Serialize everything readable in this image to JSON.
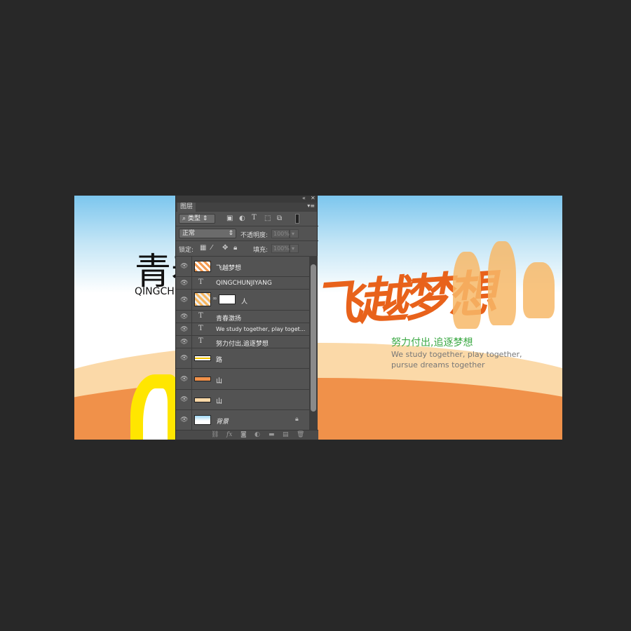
{
  "canvas": {
    "title": "青春",
    "subtitle": "QINGCHU",
    "calligraphy": "飞越梦想",
    "slogan": "努力付出,追逐梦想",
    "english_line1": "We study together, play together,",
    "english_line2": "pursue dreams together"
  },
  "panel": {
    "tab": "图层",
    "filter_kind": "类型",
    "blend_mode": "正常",
    "opacity_label": "不透明度:",
    "opacity_value": "100%",
    "lock_label": "锁定:",
    "fill_label": "填充:",
    "fill_value": "100%",
    "layers": [
      {
        "name": "飞越梦想",
        "type": "image"
      },
      {
        "name": "QINGCHUNJIYANG",
        "type": "text"
      },
      {
        "name": "人",
        "type": "image-mask"
      },
      {
        "name": "青春激扬",
        "type": "text"
      },
      {
        "name": "We study together, play toget...",
        "type": "text"
      },
      {
        "name": "努力付出,追逐梦想",
        "type": "text"
      },
      {
        "name": "路",
        "type": "image"
      },
      {
        "name": "山",
        "type": "image"
      },
      {
        "name": "山",
        "type": "image"
      },
      {
        "name": "背景",
        "type": "background",
        "locked": true
      }
    ]
  },
  "colors": {
    "accent_orange": "#e8621b",
    "dune": "#f0914a",
    "green": "#3aa843",
    "panel_bg": "#535353"
  }
}
